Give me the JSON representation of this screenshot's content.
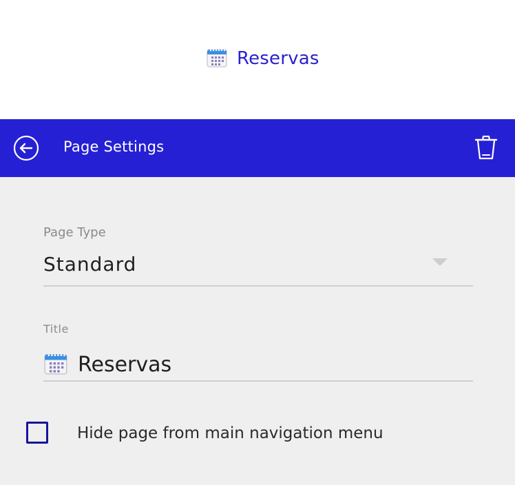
{
  "page_heading": {
    "icon": "calendar-icon",
    "label": "Reservas"
  },
  "header": {
    "title": "Page Settings",
    "background": "#2620d4",
    "back_icon": "arrow-left-circle-icon",
    "delete_icon": "trash-icon"
  },
  "form": {
    "page_type": {
      "label": "Page Type",
      "value": "Standard"
    },
    "title": {
      "label": "Title",
      "icon": "calendar-icon",
      "value": "Reservas"
    },
    "hide_from_nav": {
      "label": "Hide page from main navigation menu",
      "checked": false
    }
  },
  "colors": {
    "accent": "#2620d4",
    "heading_text": "#2b22cf",
    "panel_background": "#efefef",
    "checkbox_border": "#16149a"
  }
}
